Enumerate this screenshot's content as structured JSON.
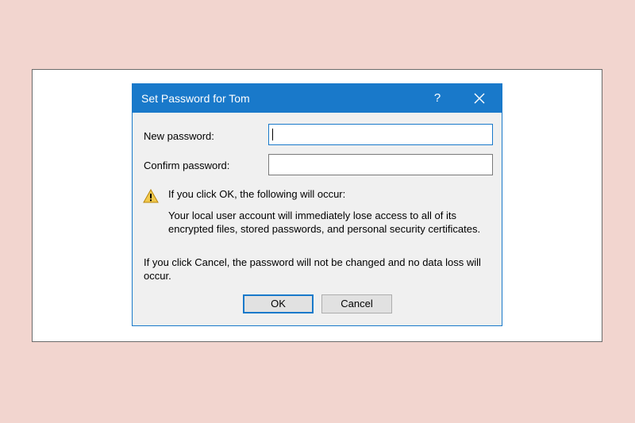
{
  "dialog": {
    "title": "Set Password for Tom",
    "help_label": "?",
    "new_password_label": "New password:",
    "new_password_value": "",
    "confirm_password_label": "Confirm password:",
    "confirm_password_value": "",
    "warning_heading": "If you click OK, the following will occur:",
    "warning_line1": "Your local user account will immediately lose access to all of its",
    "warning_line2": "encrypted files, stored passwords, and personal security certificates.",
    "cancel_line1": "If you click Cancel, the password will not be changed and no data loss will",
    "cancel_line2": "occur.",
    "ok_label": "OK",
    "cancel_label": "Cancel"
  },
  "colors": {
    "background": "#f2d5cf",
    "titlebar": "#1979ca",
    "dialog_body": "#f0f0f0",
    "warning_icon": "#f2c94c"
  },
  "icons": {
    "close": "close-icon",
    "warning": "warning-icon"
  }
}
